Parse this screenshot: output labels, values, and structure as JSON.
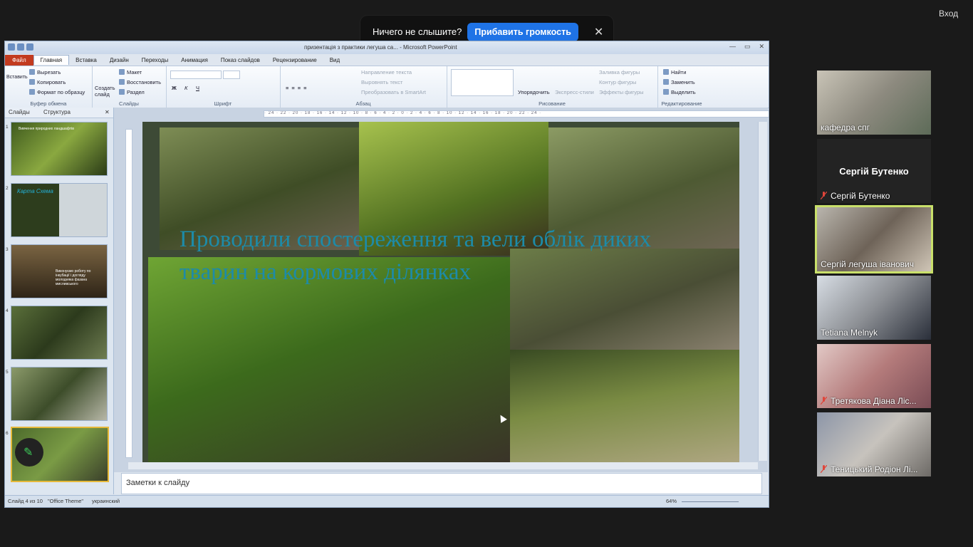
{
  "zoom": {
    "notification": {
      "message": "Ничего не слышите?",
      "action": "Прибавить громкость",
      "close": "✕"
    },
    "enter_label": "Вход"
  },
  "ppt": {
    "window_title": "призентація з практики легуша са... - Microsoft PowerPoint",
    "tabs": [
      "Файл",
      "Главная",
      "Вставка",
      "Дизайн",
      "Переходы",
      "Анимация",
      "Показ слайдов",
      "Рецензирование",
      "Вид"
    ],
    "ribbon": {
      "clipboard": {
        "label": "Буфер обмена",
        "paste": "Вставить",
        "cut": "Вырезать",
        "copy": "Копировать",
        "format_painter": "Формат по образцу"
      },
      "slides": {
        "label": "Слайды",
        "new_slide": "Создать слайд",
        "layout": "Макет",
        "reset": "Восстановить",
        "section": "Раздел"
      },
      "font": {
        "label": "Шрифт"
      },
      "paragraph": {
        "label": "Абзац",
        "text_direction": "Направление текста",
        "align_text": "Выровнять текст",
        "smartart": "Преобразовать в SmartArt"
      },
      "drawing": {
        "label": "Рисование",
        "arrange": "Упорядочить",
        "quick_styles": "Экспресс-стили",
        "shape_fill": "Заливка фигуры",
        "shape_outline": "Контур фигуры",
        "shape_effects": "Эффекты фигуры"
      },
      "editing": {
        "label": "Редактирование",
        "find": "Найти",
        "replace": "Заменить",
        "select": "Выделить"
      }
    },
    "left_tabs": {
      "slides": "Слайды",
      "outline": "Структура"
    },
    "thumbnails": [
      {
        "num": "1",
        "text": "Вивчення природних ландшафтів"
      },
      {
        "num": "2",
        "text": "Карта Схема"
      },
      {
        "num": "3",
        "text": "Виконуємо роботу по інкубації і догляду молодняка фазана мисливського"
      },
      {
        "num": "4",
        "text": ""
      },
      {
        "num": "5",
        "text": ""
      },
      {
        "num": "6",
        "text": ""
      }
    ],
    "slide_title": "Проводили спостереження та вели облік диких тварин на кормових ділянках",
    "notes_placeholder": "Заметки к слайду",
    "status": {
      "slide": "Слайд 4 из 10",
      "theme": "\"Office Theme\"",
      "language": "украинский",
      "zoom": "64%"
    }
  },
  "participants": [
    {
      "name": "кафедра спг",
      "muted": false,
      "video": true
    },
    {
      "name": "Сергій Бутенко",
      "display_big": "Сергій Бутенко",
      "muted": true,
      "video": false
    },
    {
      "name": "Сергій легуша іванович",
      "muted": false,
      "video": true,
      "active": true
    },
    {
      "name": "Tetiana Melnyk",
      "muted": false,
      "video": true
    },
    {
      "name": "Третякова Діана  Ліс...",
      "muted": true,
      "video": true
    },
    {
      "name": "Теницький Родіон Лі...",
      "muted": true,
      "video": true
    }
  ],
  "colors": {
    "zoom_blue": "#1f73e6",
    "active_speaker": "#c9e06a",
    "title_teal": "#1d8ba8",
    "file_tab": "#c23b1f"
  }
}
